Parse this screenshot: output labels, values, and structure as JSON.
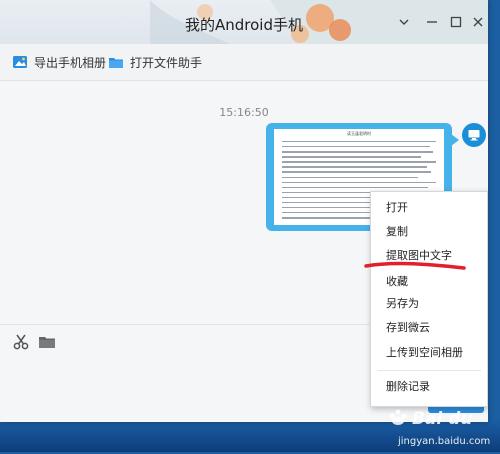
{
  "window": {
    "title": "我的Android手机",
    "controls": {
      "menu_icon": "chevron-down-icon",
      "minimize_icon": "minimize-icon",
      "maximize_icon": "maximize-icon",
      "close_icon": "close-icon"
    }
  },
  "toolbar": {
    "items": [
      {
        "label": "导出手机相册",
        "icon": "photo-export-icon"
      },
      {
        "label": "打开文件助手",
        "icon": "folder-icon"
      }
    ]
  },
  "chat": {
    "timestamp": "15:16:50",
    "image_message": {
      "doc_title": "读玉逢君明时",
      "line_count": 16
    }
  },
  "composer": {
    "tools": [
      "scissors-icon",
      "folder-icon"
    ]
  },
  "context_menu": {
    "items": [
      {
        "label": "打开"
      },
      {
        "label": "复制"
      },
      {
        "label": "提取图中文字"
      },
      {
        "label": "收藏"
      },
      {
        "label": "另存为"
      },
      {
        "label": "存到微云"
      },
      {
        "label": "上传到空间相册"
      },
      {
        "label": "删除记录"
      }
    ]
  },
  "colors": {
    "accent": "#46b2ea",
    "annotation": "#e0202a",
    "desktop": "#1c5fa3"
  }
}
